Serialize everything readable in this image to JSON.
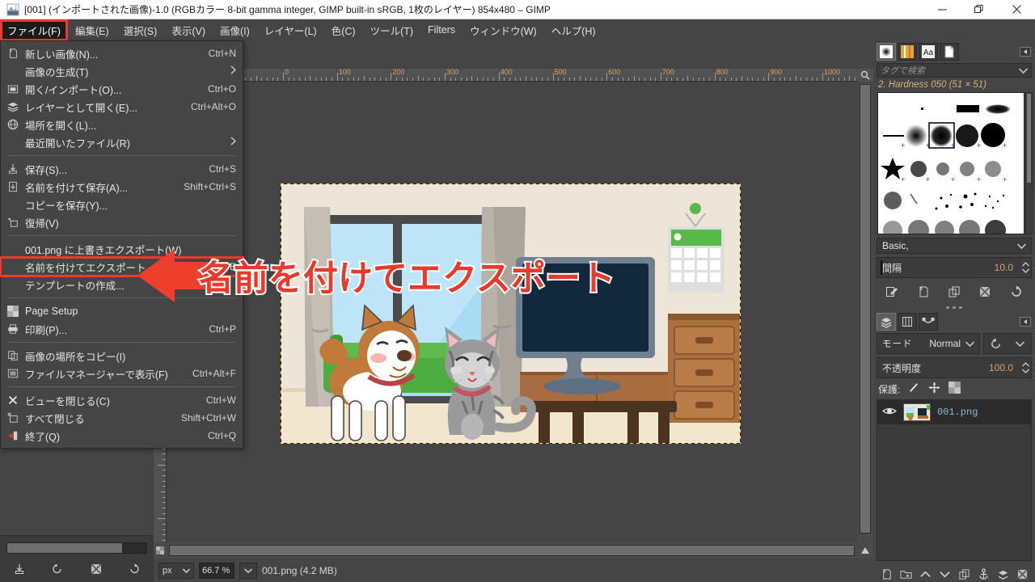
{
  "window": {
    "title": "[001] (インポートされた画像)-1.0 (RGBカラー 8-bit gamma integer, GIMP built-in sRGB, 1枚のレイヤー) 854x480 – GIMP",
    "app_icon": "gimp-icon",
    "minimize": "–",
    "maximize": "❐",
    "close": "✕"
  },
  "menubar": {
    "items": [
      {
        "label": "ファイル(F)",
        "name": "menu-file",
        "active": true
      },
      {
        "label": "編集(E)",
        "name": "menu-edit",
        "active": false
      },
      {
        "label": "選択(S)",
        "name": "menu-select",
        "active": false
      },
      {
        "label": "表示(V)",
        "name": "menu-view",
        "active": false
      },
      {
        "label": "画像(I)",
        "name": "menu-image",
        "active": false
      },
      {
        "label": "レイヤー(L)",
        "name": "menu-layer",
        "active": false
      },
      {
        "label": "色(C)",
        "name": "menu-colors",
        "active": false
      },
      {
        "label": "ツール(T)",
        "name": "menu-tools",
        "active": false
      },
      {
        "label": "Filters",
        "name": "menu-filters",
        "active": false
      },
      {
        "label": "ウィンドウ(W)",
        "name": "menu-windows",
        "active": false
      },
      {
        "label": "ヘルプ(H)",
        "name": "menu-help",
        "active": false
      }
    ]
  },
  "file_menu": {
    "groups": [
      {
        "items": [
          {
            "label": "新しい画像(N)...",
            "accel": "Ctrl+N",
            "icon": "new-image-icon",
            "submenu": false
          },
          {
            "label": "画像の生成(T)",
            "accel": "",
            "icon": "",
            "submenu": true
          },
          {
            "label": "開く/インポート(O)...",
            "accel": "Ctrl+O",
            "icon": "open-icon",
            "submenu": false
          },
          {
            "label": "レイヤーとして開く(E)...",
            "accel": "Ctrl+Alt+O",
            "icon": "open-as-layers-icon",
            "submenu": false
          },
          {
            "label": "場所を開く(L)...",
            "accel": "",
            "icon": "open-location-icon",
            "submenu": false
          },
          {
            "label": "最近開いたファイル(R)",
            "accel": "",
            "icon": "",
            "submenu": true
          }
        ]
      },
      {
        "items": [
          {
            "label": "保存(S)...",
            "accel": "Ctrl+S",
            "icon": "save-icon",
            "submenu": false
          },
          {
            "label": "名前を付けて保存(A)...",
            "accel": "Shift+Ctrl+S",
            "icon": "save-as-icon",
            "submenu": false
          },
          {
            "label": "コピーを保存(Y)...",
            "accel": "",
            "icon": "",
            "submenu": false
          },
          {
            "label": "復帰(V)",
            "accel": "",
            "icon": "revert-icon",
            "submenu": false
          }
        ]
      },
      {
        "items": [
          {
            "label": "001.png に上書きエクスポート(W)",
            "accel": "",
            "icon": "",
            "submenu": false
          },
          {
            "label": "名前を付けてエクスポート...",
            "accel": "Shift+Ctrl+E",
            "icon": "",
            "submenu": false,
            "highlight": true
          },
          {
            "label": "テンプレートの作成...",
            "accel": "",
            "icon": "",
            "submenu": false
          }
        ]
      },
      {
        "items": [
          {
            "label": "Page Setup",
            "accel": "",
            "icon": "page-setup-icon",
            "submenu": false
          },
          {
            "label": "印刷(P)...",
            "accel": "Ctrl+P",
            "icon": "print-icon",
            "submenu": false
          }
        ]
      },
      {
        "items": [
          {
            "label": "画像の場所をコピー(I)",
            "accel": "",
            "icon": "copy-location-icon",
            "submenu": false
          },
          {
            "label": "ファイルマネージャーで表示(F)",
            "accel": "Ctrl+Alt+F",
            "icon": "show-in-file-manager-icon",
            "submenu": false
          }
        ]
      },
      {
        "items": [
          {
            "label": "ビューを閉じる(C)",
            "accel": "Ctrl+W",
            "icon": "close-view-icon",
            "submenu": false
          },
          {
            "label": "すべて閉じる",
            "accel": "Shift+Ctrl+W",
            "icon": "close-all-icon",
            "submenu": false
          },
          {
            "label": "終了(Q)",
            "accel": "Ctrl+Q",
            "icon": "quit-icon",
            "submenu": false
          }
        ]
      }
    ]
  },
  "annotation": {
    "text": "名前を付けてエクスポート",
    "arrow_color": "#ee3f2d",
    "text_color": "#e8392b",
    "text_outline": "#ffffff"
  },
  "rulers": {
    "horizontal_labels": [
      "0",
      "100",
      "200",
      "300",
      "400",
      "500",
      "600",
      "700",
      "800",
      "900",
      "1000"
    ],
    "vertical_labels": [
      "600"
    ],
    "unit": "px"
  },
  "statusbar": {
    "unit": "px",
    "zoom": "66.7 %",
    "message": "001.png (4.2 MB)"
  },
  "dock": {
    "tabs": [
      {
        "name": "tab-brushes",
        "icon": "brush-icon",
        "selected": true
      },
      {
        "name": "tab-patterns",
        "icon": "pattern-icon",
        "selected": false
      },
      {
        "name": "tab-fonts",
        "icon": "font-icon",
        "selected": false
      },
      {
        "name": "tab-documents",
        "icon": "document-icon",
        "selected": false
      }
    ],
    "tag_search_placeholder": "タグで検索",
    "brush_name": "2. Hardness 050 (51 × 51)",
    "brush_set": "Basic,",
    "spacing_label": "間隔",
    "spacing_value": "10.0",
    "brush_actions": [
      "edit-brush-icon",
      "new-brush-icon",
      "duplicate-brush-icon",
      "delete-brush-icon",
      "refresh-brushes-icon"
    ]
  },
  "layers": {
    "tabs": [
      {
        "name": "tab-layers",
        "icon": "layers-icon",
        "selected": true
      },
      {
        "name": "tab-channels",
        "icon": "channels-icon",
        "selected": false
      },
      {
        "name": "tab-paths",
        "icon": "paths-icon",
        "selected": false
      }
    ],
    "mode_label": "モード",
    "mode_value": "Normal",
    "opacity_label": "不透明度",
    "opacity_value": "100.0",
    "lock_label": "保護:",
    "lock_icons": [
      "lock-pixels-icon",
      "lock-position-icon",
      "lock-alpha-icon"
    ],
    "rows": [
      {
        "name": "001.png",
        "visible": true,
        "thumb": "layer-thumbnail"
      }
    ],
    "actions": [
      "new-layer-icon",
      "new-layer-group-icon",
      "raise-layer-icon",
      "lower-layer-icon",
      "duplicate-layer-icon",
      "anchor-layer-icon",
      "merge-down-icon",
      "delete-layer-icon"
    ]
  },
  "toolwell": {
    "actions": [
      "save-tool-options-icon",
      "restore-tool-options-icon",
      "delete-tool-options-icon",
      "reset-tool-options-icon"
    ]
  },
  "canvas": {
    "image_name": "001.png",
    "image_size": "854x480",
    "description": "室内のイラスト: 犬と猫、テレビ、カレンダー、タンス、窓"
  }
}
